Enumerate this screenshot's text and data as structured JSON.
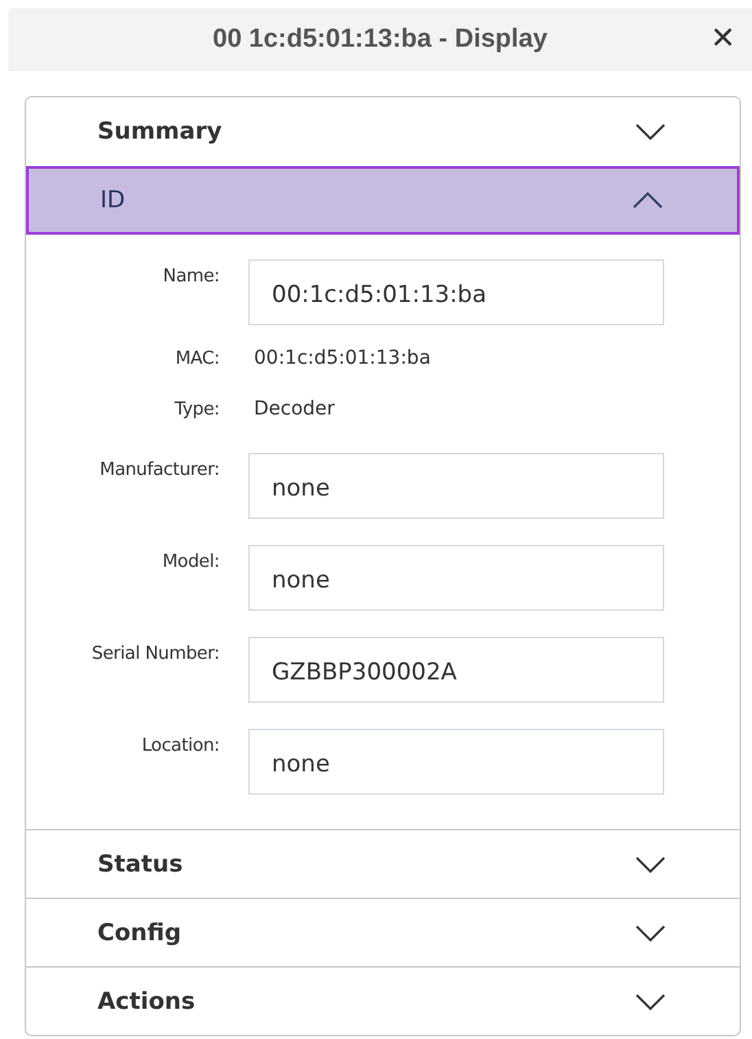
{
  "window": {
    "title": "00 1c:d5:01:13:ba - Display",
    "close": "✕"
  },
  "sections": [
    {
      "title": "Summary",
      "expanded": false
    },
    {
      "title": "ID",
      "expanded": true,
      "fields": [
        {
          "label": "Name:",
          "kind": "input",
          "value": "00:1c:d5:01:13:ba"
        },
        {
          "label": "MAC:",
          "kind": "text",
          "value": "00:1c:d5:01:13:ba"
        },
        {
          "label": "Type:",
          "kind": "text",
          "value": "Decoder"
        },
        {
          "label": "Manufacturer:",
          "kind": "input",
          "value": "none"
        },
        {
          "label": "Model:",
          "kind": "input",
          "value": "none"
        },
        {
          "label": "Serial Number:",
          "kind": "input",
          "value": "GZBBP300002A"
        },
        {
          "label": "Location:",
          "kind": "input",
          "value": "none"
        }
      ]
    },
    {
      "title": "Status",
      "expanded": false
    },
    {
      "title": "Config",
      "expanded": false
    },
    {
      "title": "Actions",
      "expanded": false
    }
  ]
}
